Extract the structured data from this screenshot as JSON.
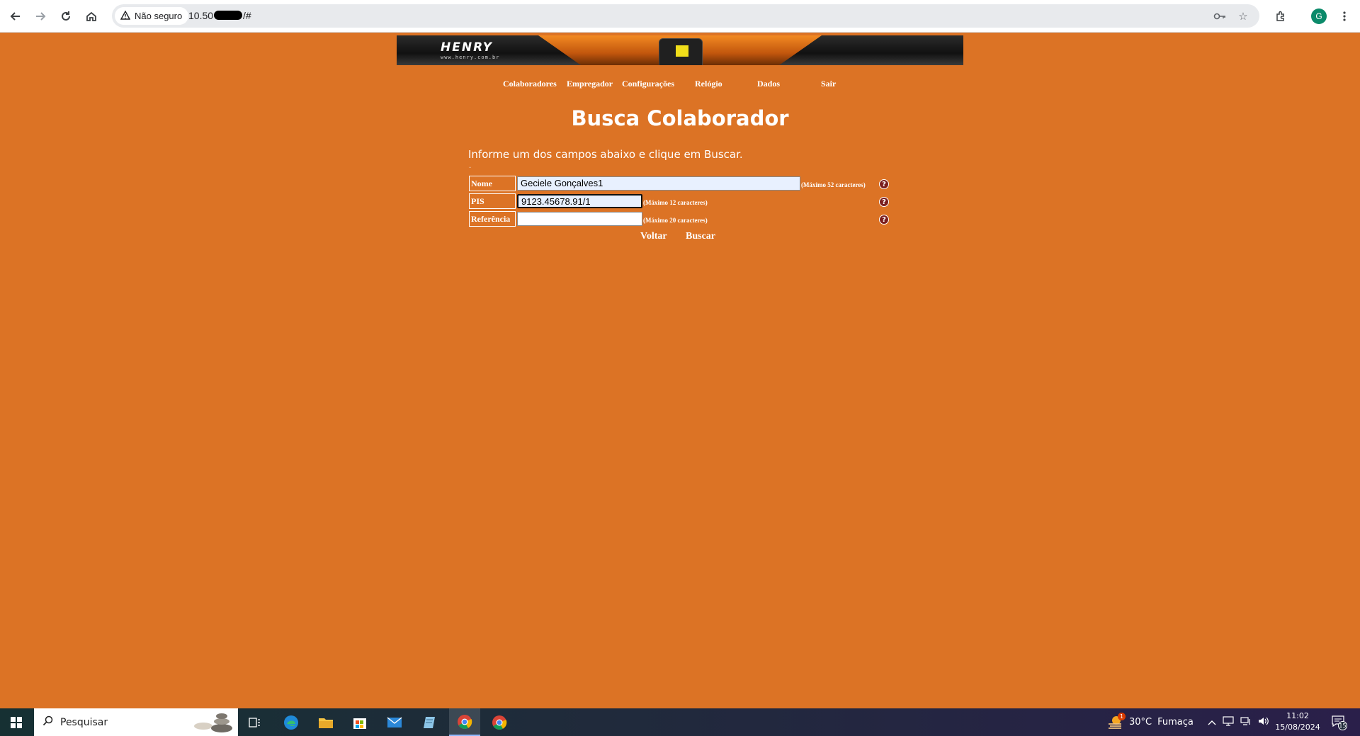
{
  "browser": {
    "security_label": "Não seguro",
    "url_prefix": "10.50",
    "url_suffix": "/#",
    "profile_initial": "G"
  },
  "banner": {
    "logo": "HENRY",
    "logo_url": "www.henry.com.br"
  },
  "menu": {
    "items": [
      "Colaboradores",
      "Empregador",
      "Configurações",
      "Relógio",
      "Dados",
      "Sair"
    ]
  },
  "page": {
    "title": "Busca Colaborador",
    "instructions": "Informe um dos campos abaixo e clique em Buscar.",
    "dot": "."
  },
  "form": {
    "nome": {
      "label": "Nome",
      "value": "Geciele Gonçalves1",
      "hint": "(Máximo 52 caracteres)"
    },
    "pis": {
      "label": "PIS",
      "value": "9123.45678.91/1",
      "hint": "(Máximo 12 caracteres)"
    },
    "referencia": {
      "label": "Referência",
      "value": "",
      "hint": "(Máximo 20 caracteres)"
    },
    "help_glyph": "?"
  },
  "actions": {
    "back": "Voltar",
    "search": "Buscar"
  },
  "taskbar": {
    "search_label": "Pesquisar",
    "weather": "30°C",
    "weather_desc": "Fumaça",
    "weather_badge": "1",
    "time": "11:02",
    "date": "15/08/2024",
    "notifications": "15"
  }
}
